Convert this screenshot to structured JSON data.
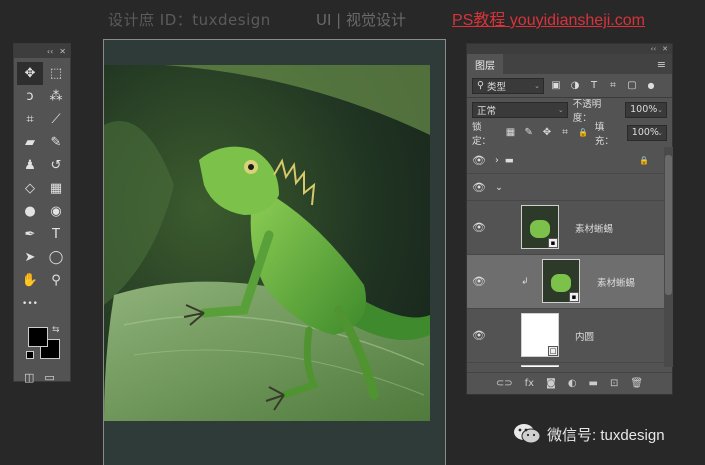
{
  "watermark": {
    "left": "设计庶 ID：tuxdesign",
    "center": "UI | 视觉设计",
    "right": "PS教程 youyidiansheji.com"
  },
  "tools_panel": {
    "header_collapse": "‹‹",
    "header_close": "✕",
    "tools": [
      {
        "name": "move",
        "glyph": "✥"
      },
      {
        "name": "marquee",
        "glyph": "⬚"
      },
      {
        "name": "lasso",
        "glyph": "ↄ"
      },
      {
        "name": "magic-wand",
        "glyph": "⁂"
      },
      {
        "name": "crop",
        "glyph": "⌗"
      },
      {
        "name": "eyedropper",
        "glyph": "⟋"
      },
      {
        "name": "healing-brush",
        "glyph": "▰"
      },
      {
        "name": "brush",
        "glyph": "✎"
      },
      {
        "name": "stamp",
        "glyph": "♟"
      },
      {
        "name": "history-brush",
        "glyph": "↺"
      },
      {
        "name": "eraser",
        "glyph": "◇"
      },
      {
        "name": "gradient",
        "glyph": "▦"
      },
      {
        "name": "blur",
        "glyph": "●"
      },
      {
        "name": "dodge",
        "glyph": "◉"
      },
      {
        "name": "pen",
        "glyph": "✒"
      },
      {
        "name": "type",
        "glyph": "T"
      },
      {
        "name": "path-select",
        "glyph": "➤"
      },
      {
        "name": "ellipse",
        "glyph": "◯"
      },
      {
        "name": "hand",
        "glyph": "✋"
      },
      {
        "name": "zoom",
        "glyph": "⚲"
      },
      {
        "name": "more",
        "glyph": "•••"
      }
    ],
    "swap_glyph": "⇆",
    "bottom_left": "◫",
    "bottom_right": "▭"
  },
  "layers_panel": {
    "collapse": "‹‹",
    "close": "✕",
    "tab_label": "图层",
    "menu_glyph": "≡",
    "filter_kind": "类型",
    "filter_icons": [
      "▣",
      "◑",
      "T",
      "⌗",
      "▢",
      "●"
    ],
    "blend_mode": "正常",
    "opacity_label": "不透明度：",
    "opacity_value": "100%",
    "lock_label": "锁定：",
    "lock_icons": [
      "▦",
      "✎",
      "✥",
      "⌗",
      "🔒"
    ],
    "fill_label": "填充：",
    "fill_value": "100%",
    "layers": [
      {
        "name": "",
        "kind": "group",
        "expand": "›",
        "lock": "🔒"
      },
      {
        "name": "",
        "kind": "group-open",
        "expand": "⌄"
      },
      {
        "name": "素材蜥蜴",
        "kind": "smart"
      },
      {
        "name": "素材蜥蜴",
        "kind": "smart-clipped",
        "selected": true
      },
      {
        "name": "内圆",
        "kind": "shape"
      },
      {
        "name": "",
        "kind": "shape"
      }
    ],
    "footer_icons": [
      "⊂⊃",
      "fx",
      "◙",
      "◐",
      "▬",
      "⊡",
      "🗑"
    ]
  },
  "wechat": {
    "label": "微信号: tuxdesign"
  }
}
